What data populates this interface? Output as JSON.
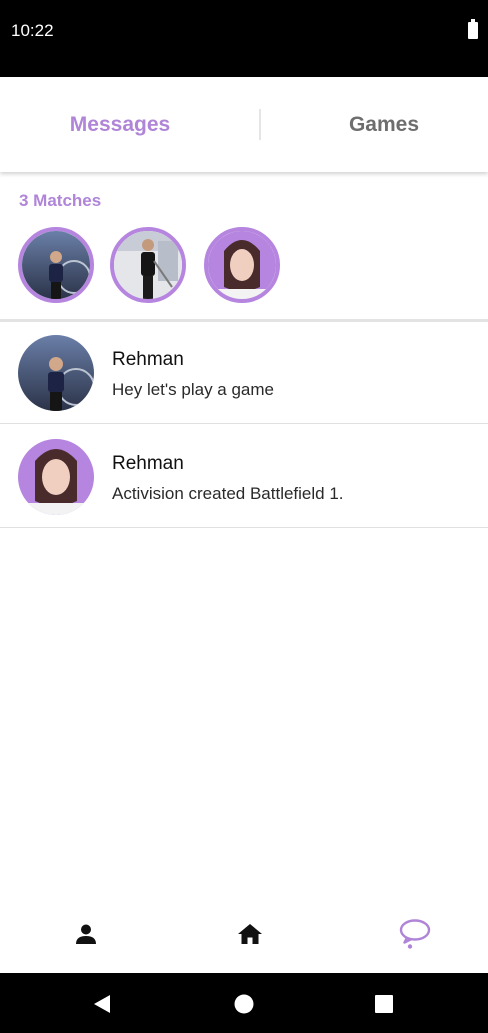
{
  "status_bar": {
    "time": "10:22"
  },
  "tabs": [
    {
      "label": "Messages",
      "active": true
    },
    {
      "label": "Games",
      "active": false
    }
  ],
  "matches": {
    "title": "3 Matches",
    "avatars": [
      "profile-photo-man-bike",
      "profile-photo-man-street",
      "profile-photo-woman"
    ]
  },
  "messages": [
    {
      "name": "Rehman",
      "preview": "Hey let's play a game",
      "avatar": "profile-photo-man-bike"
    },
    {
      "name": "Rehman",
      "preview": "Activision created Battlefield 1.",
      "avatar": "profile-photo-woman"
    }
  ],
  "bottom_nav": [
    {
      "icon": "person-icon",
      "active": false
    },
    {
      "icon": "home-icon",
      "active": false
    },
    {
      "icon": "chat-bubble-icon",
      "active": true
    }
  ],
  "system_nav": [
    "back-icon",
    "home-circle-icon",
    "recents-icon"
  ],
  "colors": {
    "accent": "#b085d8",
    "avatar_ring": "#b585df",
    "inactive_tab": "#6e6e6e"
  }
}
